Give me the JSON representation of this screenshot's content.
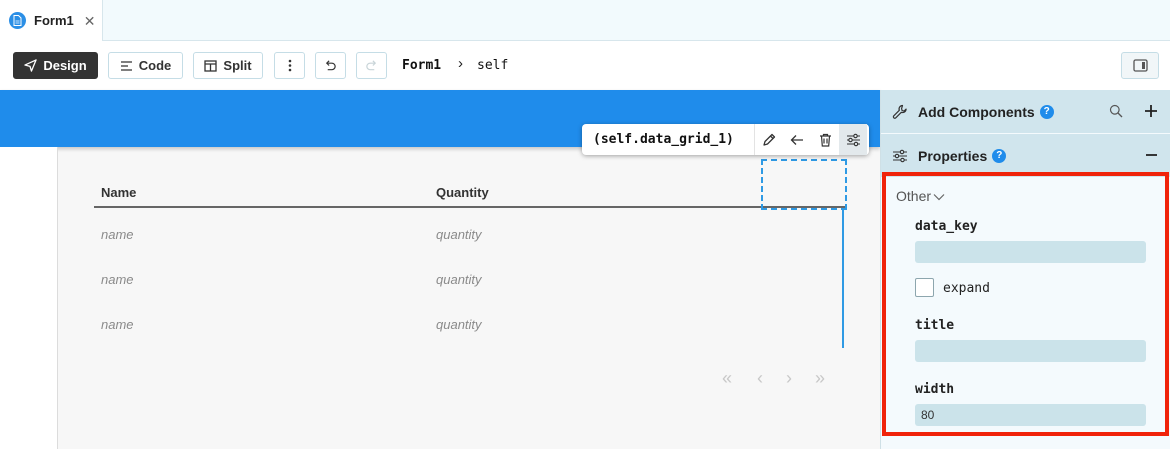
{
  "tabs": [
    {
      "label": "Form1",
      "icon": "form-file-icon",
      "active": true
    }
  ],
  "toolbar": {
    "design_label": "Design",
    "code_label": "Code",
    "split_label": "Split",
    "breadcrumb_form": "Form1",
    "breadcrumb_sep": "›",
    "breadcrumb_self": "self"
  },
  "canvas": {
    "component_name": "(self.data_grid_1)",
    "columns": [
      "Name",
      "Quantity"
    ],
    "rows": [
      [
        "name",
        "quantity"
      ],
      [
        "name",
        "quantity"
      ],
      [
        "name",
        "quantity"
      ]
    ],
    "pager": [
      "«",
      "‹",
      "›",
      "»"
    ]
  },
  "panel": {
    "add_components_label": "Add Components",
    "properties_label": "Properties",
    "help_glyph": "?",
    "group_label": "Other",
    "data_key_label": "data_key",
    "data_key_value": "",
    "expand_label": "expand",
    "expand_checked": false,
    "title_label": "title",
    "title_value": "",
    "width_label": "width",
    "width_value": "80"
  },
  "colors": {
    "accent": "#1f8ceb",
    "highlight_border": "#f0230a",
    "panel_header": "#d0e5ed",
    "input_bg": "#cbe3ea"
  }
}
